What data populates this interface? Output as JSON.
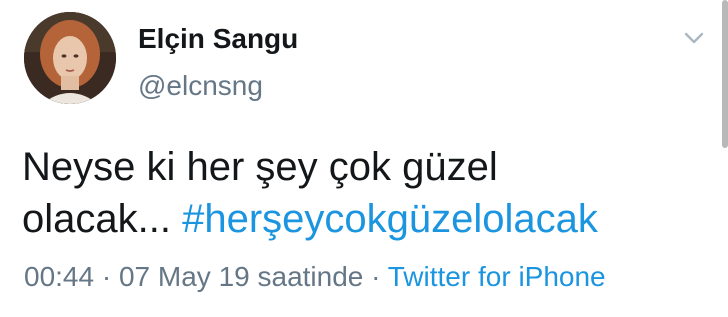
{
  "user": {
    "name": "Elçin Sangu",
    "handle": "@elcnsng"
  },
  "tweet": {
    "text_line1": "Neyse ki her şey çok güzel",
    "text_line2": "olacak...",
    "hashtag": "#herşeycokgüzelolacak"
  },
  "meta": {
    "time": "00:44",
    "separator": " · ",
    "date": "07 May 19 saatinde",
    "source": "Twitter for iPhone"
  },
  "icons": {
    "caret": "chevron-down-icon"
  },
  "colors": {
    "link": "#1b95e0",
    "secondary_text": "#657786",
    "primary_text": "#14171a"
  }
}
